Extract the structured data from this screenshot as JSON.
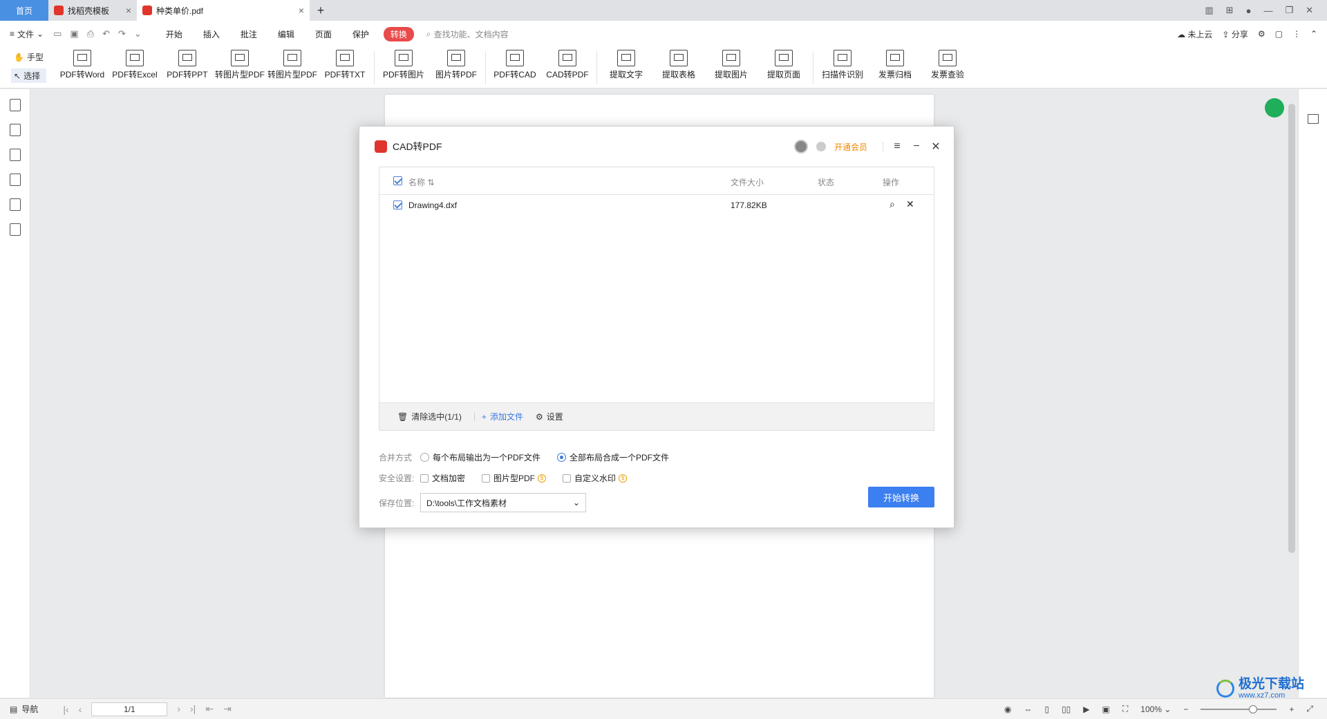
{
  "tabs": {
    "home": "首页",
    "items": [
      {
        "label": "找稻壳模板",
        "close": "×"
      },
      {
        "label": "种类单价.pdf",
        "close": "×"
      }
    ],
    "add": "+"
  },
  "menubar": {
    "file": "文件",
    "items": [
      "开始",
      "插入",
      "批注",
      "编辑",
      "页面",
      "保护"
    ],
    "active": "转换",
    "search_placeholder": "查找功能、文档内容",
    "cloud": "未上云",
    "share": "分享"
  },
  "ribbon": {
    "modes": [
      "手型",
      "选择"
    ],
    "groups": [
      [
        "PDF转Word",
        "PDF转Excel",
        "PDF转PPT",
        "转图片型PDF",
        "转图片型PDF",
        "PDF转TXT"
      ],
      [
        "PDF转图片",
        "图片转PDF"
      ],
      [
        "PDF转CAD",
        "CAD转PDF"
      ],
      [
        "提取文字",
        "提取表格",
        "提取图片",
        "提取页面"
      ],
      [
        "扫描件识别",
        "发票归档",
        "发票查验"
      ]
    ]
  },
  "dialog": {
    "title": "CAD转PDF",
    "vip": "开通会员",
    "columns": {
      "name": "名称",
      "size": "文件大小",
      "status": "状态",
      "action": "操作"
    },
    "files": [
      {
        "name": "Drawing4.dxf",
        "size": "177.82KB",
        "status": ""
      }
    ],
    "footer": {
      "clear": "清除选中(1/1)",
      "add": "添加文件",
      "settings": "设置"
    },
    "merge": {
      "label": "合并方式",
      "option1": "每个布局输出为一个PDF文件",
      "option2": "全部布局合成一个PDF文件"
    },
    "security": {
      "label": "安全设置:",
      "encrypt": "文档加密",
      "image_pdf": "图片型PDF",
      "watermark": "自定义水印"
    },
    "save": {
      "label": "保存位置:",
      "path": "D:\\tools\\工作文档素材"
    },
    "start": "开始转换"
  },
  "statusbar": {
    "nav": "导航",
    "page": "1/1",
    "zoom": "100%"
  },
  "watermark": {
    "title": "极光下载站",
    "url": "www.xz7.com"
  }
}
